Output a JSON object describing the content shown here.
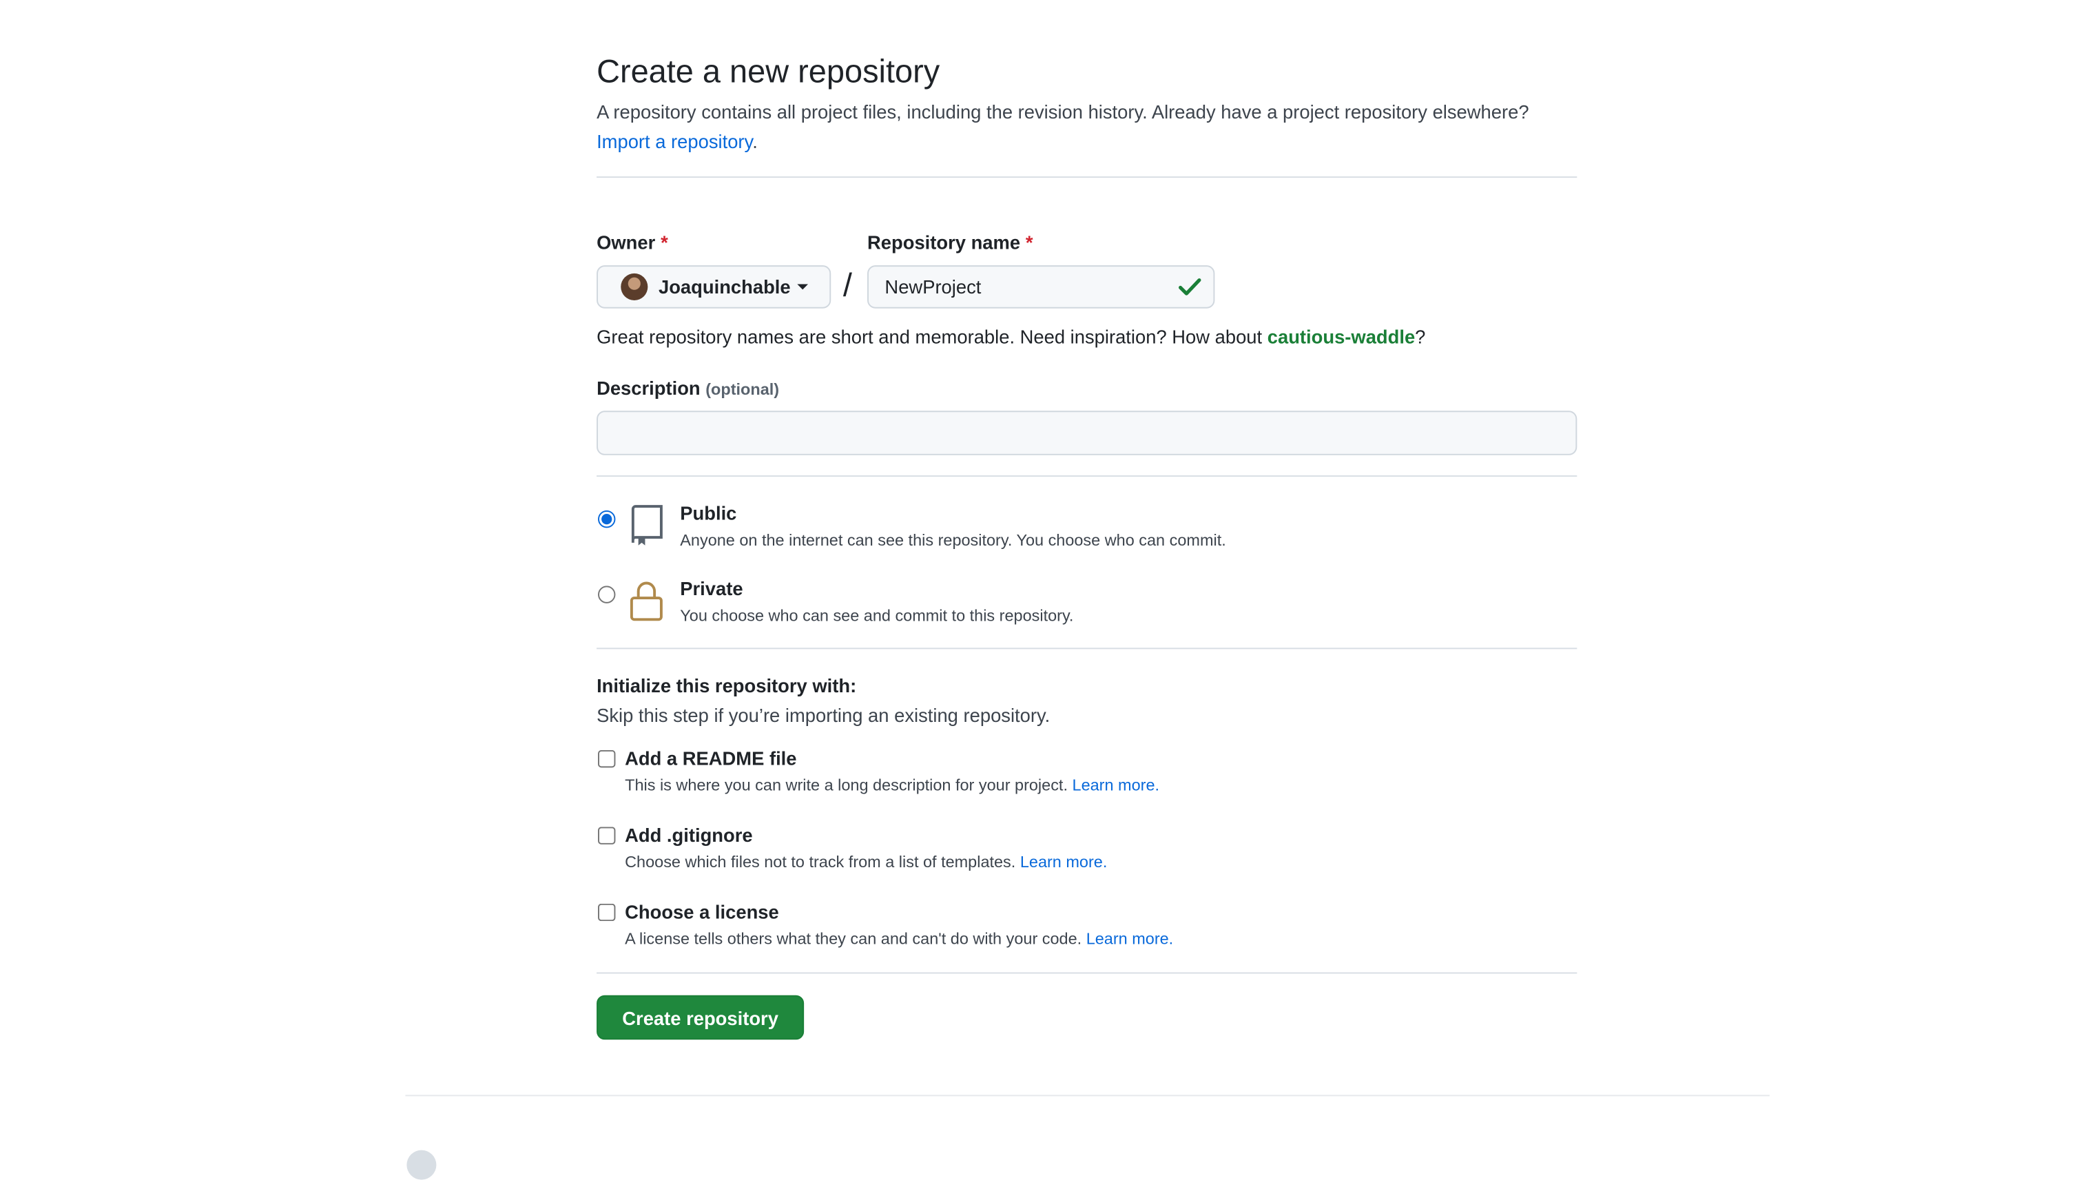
{
  "page": {
    "title": "Create a new repository",
    "intro_text": "A repository contains all project files, including the revision history. Already have a project repository elsewhere?",
    "import_link": "Import a repository",
    "intro_end": "."
  },
  "owner": {
    "label": "Owner",
    "required_mark": "*",
    "value": "Joaquinchable"
  },
  "repo_name": {
    "label": "Repository name",
    "required_mark": "*",
    "value": "NewProject",
    "separator": "/",
    "valid": true
  },
  "hint": {
    "text": "Great repository names are short and memorable. Need inspiration? How about",
    "suggestion": "cautious-waddle",
    "end": "?"
  },
  "description": {
    "label": "Description",
    "optional_label": "(optional)",
    "value": "",
    "placeholder": ""
  },
  "visibility": {
    "selected": "public",
    "options": [
      {
        "key": "public",
        "title": "Public",
        "desc": "Anyone on the internet can see this repository. You choose who can commit.",
        "icon": "repo-icon"
      },
      {
        "key": "private",
        "title": "Private",
        "desc": "You choose who can see and commit to this repository.",
        "icon": "lock-icon"
      }
    ]
  },
  "init": {
    "heading": "Initialize this repository with:",
    "subheading": "Skip this step if you’re importing an existing repository.",
    "options": [
      {
        "title": "Add a README file",
        "desc": "This is where you can write a long description for your project.",
        "link": "Learn more.",
        "checked": false
      },
      {
        "title": "Add .gitignore",
        "desc": "Choose which files not to track from a list of templates.",
        "link": "Learn more.",
        "checked": false
      },
      {
        "title": "Choose a license",
        "desc": "A license tells others what they can and can't do with your code.",
        "link": "Learn more.",
        "checked": false
      }
    ]
  },
  "submit": {
    "label": "Create repository"
  },
  "colors": {
    "primary_button": "#1f883d",
    "link": "#0969da",
    "suggestion": "#1a7f37",
    "required": "#d1242f",
    "lock_icon": "#b08a4c"
  }
}
